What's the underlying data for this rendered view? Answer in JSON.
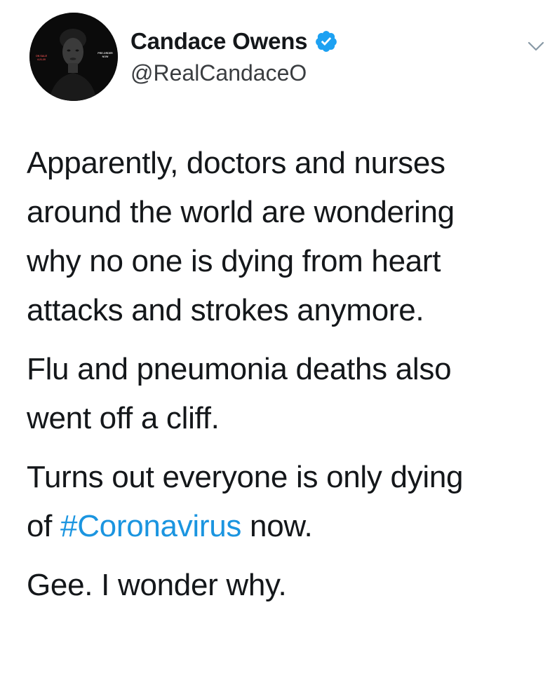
{
  "author": {
    "display_name": "Candace Owens",
    "handle": "@RealCandaceO",
    "verified": true,
    "avatar": {
      "alt": "profile-photo",
      "badge_left": "ON SALE 4.21.20",
      "badge_right": "PRE-ORDER NOW"
    }
  },
  "menu": {
    "icon": "chevron-down-icon"
  },
  "tweet": {
    "paragraph_1": {
      "line_1": "Apparently, doctors and nurses",
      "line_2": "around the world are wondering",
      "line_3": "why no one is dying from heart",
      "line_4": "attacks and strokes anymore."
    },
    "paragraph_2": {
      "line_1": "Flu and pneumonia deaths also",
      "line_2": "went off a cliff."
    },
    "paragraph_3": {
      "line_1": "Turns out everyone is only dying",
      "line_2_prefix": "of ",
      "hashtag": "#Coronavirus",
      "line_2_suffix": " now."
    },
    "paragraph_4": {
      "line_1": "Gee. I wonder why."
    }
  },
  "colors": {
    "text": "#14171a",
    "handle": "#3a3d40",
    "link": "#1b95e0",
    "verified_badge": "#1da1f2",
    "chevron": "#8899a6"
  }
}
